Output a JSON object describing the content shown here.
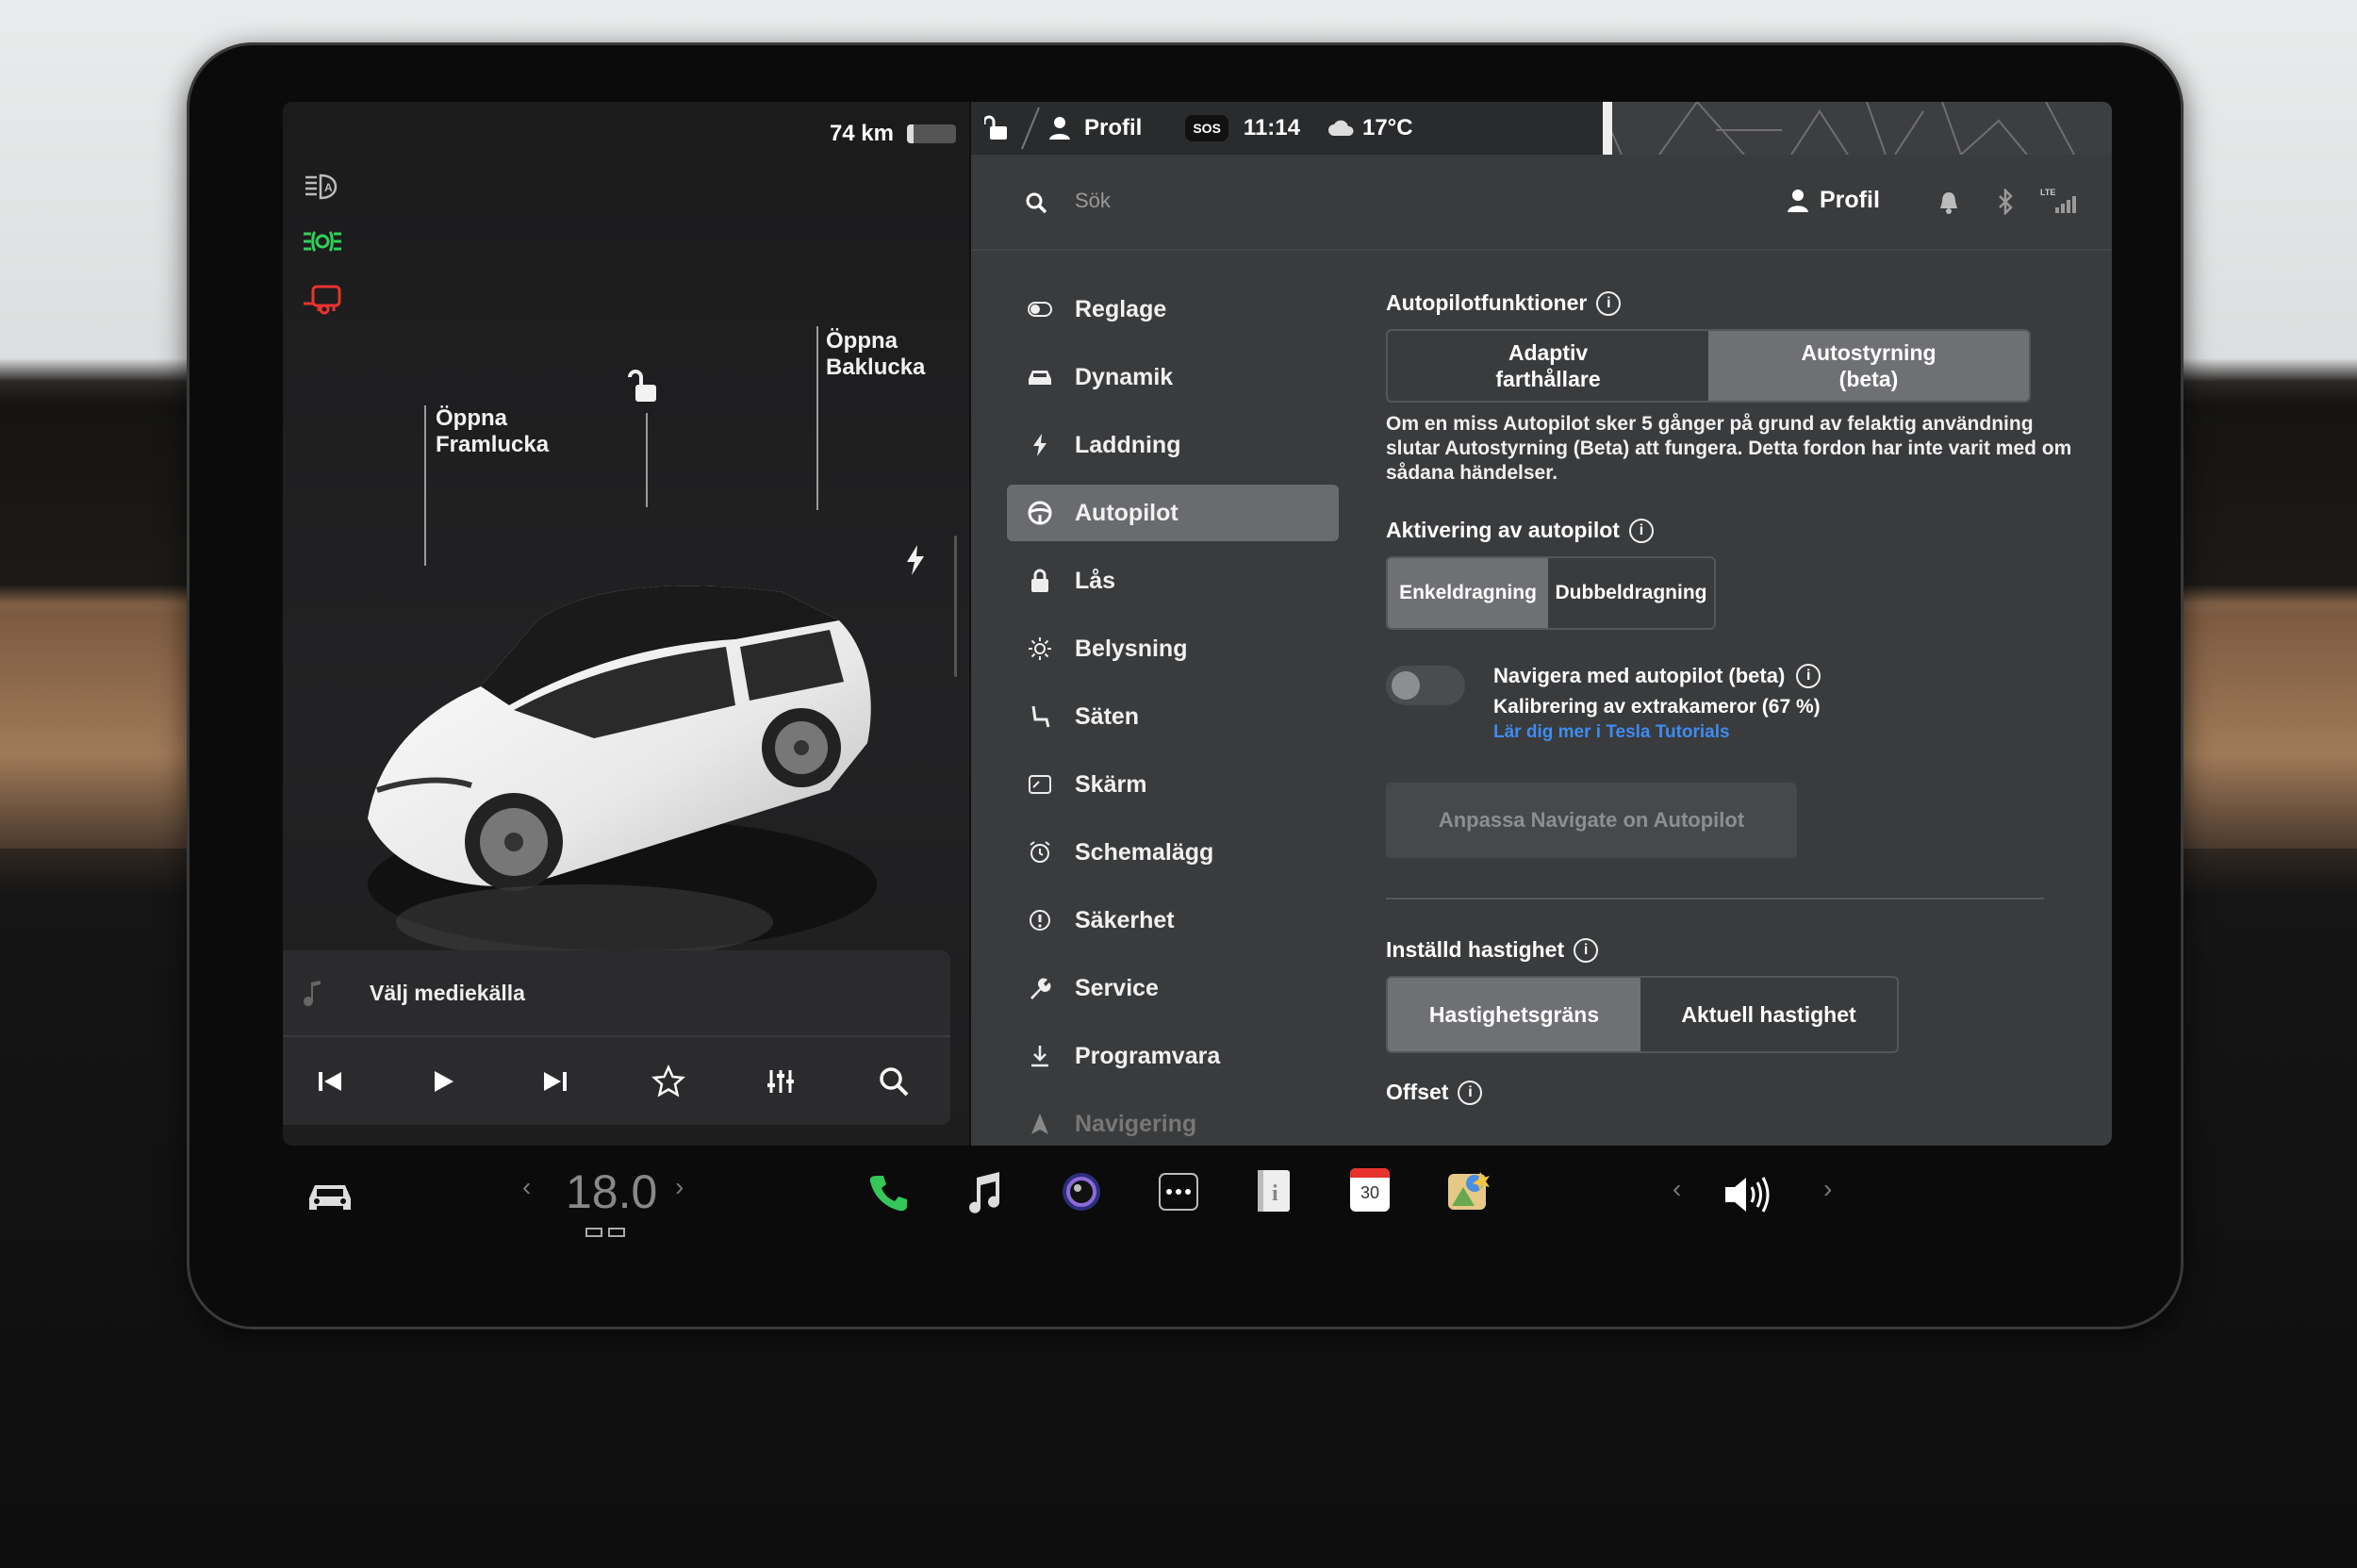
{
  "status": {
    "range": "74 km",
    "profile": "Profil",
    "sos": "SOS",
    "time": "11:14",
    "temperature": "17°C",
    "battery_level": 0.14
  },
  "car": {
    "frunk_label": "Öppna\nFramlucka",
    "trunk_label": "Öppna\nBaklucka"
  },
  "media": {
    "source_label": "Välj mediekälla"
  },
  "search": {
    "placeholder": "Sök",
    "profile": "Profil"
  },
  "menu": [
    {
      "label": "Reglage",
      "icon": "toggle-icon"
    },
    {
      "label": "Dynamik",
      "icon": "car-icon"
    },
    {
      "label": "Laddning",
      "icon": "bolt-icon"
    },
    {
      "label": "Autopilot",
      "icon": "steering-wheel-icon",
      "active": true
    },
    {
      "label": "Lås",
      "icon": "lock-icon"
    },
    {
      "label": "Belysning",
      "icon": "sun-icon"
    },
    {
      "label": "Säten",
      "icon": "seat-icon"
    },
    {
      "label": "Skärm",
      "icon": "display-icon"
    },
    {
      "label": "Schemalägg",
      "icon": "alarm-icon"
    },
    {
      "label": "Säkerhet",
      "icon": "alert-icon"
    },
    {
      "label": "Service",
      "icon": "wrench-icon"
    },
    {
      "label": "Programvara",
      "icon": "download-icon"
    },
    {
      "label": "Navigering",
      "icon": "navigation-icon"
    }
  ],
  "autopilot": {
    "features_title": "Autopilotfunktioner",
    "features_options": [
      "Adaptiv\nfarthållare",
      "Autostyrning\n(beta)"
    ],
    "features_selected": 1,
    "warning": "Om en miss Autopilot sker 5 gånger på grund av felaktig användning slutar Autostyrning (Beta) att fungera. Detta fordon har inte varit med om sådana händelser.",
    "activation_title": "Aktivering av autopilot",
    "activation_options": [
      "Enkeldragning",
      "Dubbeldragning"
    ],
    "activation_selected": 0,
    "nav_title": "Navigera med autopilot (beta)",
    "nav_subtitle": "Kalibrering av extrakameror (67 %)",
    "nav_link": "Lär dig mer i Tesla Tutorials",
    "nav_enabled": false,
    "customize_button": "Anpassa Navigate on Autopilot",
    "speed_title": "Inställd hastighet",
    "speed_options": [
      "Hastighetsgräns",
      "Aktuell hastighet"
    ],
    "speed_selected": 0,
    "offset_title": "Offset"
  },
  "dock": {
    "temp_value": "18.0",
    "calendar_day": "30"
  },
  "colors": {
    "accent_blue": "#3e8cf0",
    "headlight_green": "#2ed158",
    "warning_red": "#e8332f",
    "phone_green": "#35c759"
  }
}
